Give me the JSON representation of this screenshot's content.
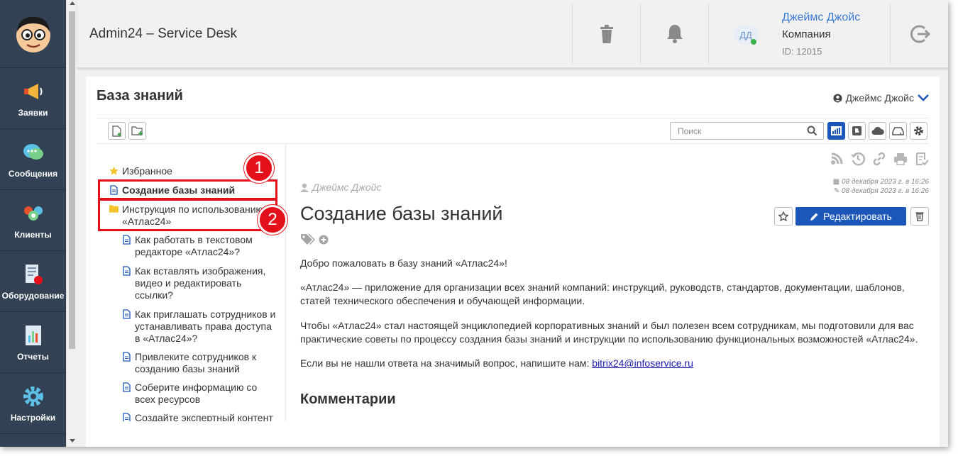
{
  "sidebar": {
    "items": [
      {
        "label": "Заявки",
        "icon": "megaphone-icon"
      },
      {
        "label": "Сообщения",
        "icon": "chat-bubble-icon"
      },
      {
        "label": "Клиенты",
        "icon": "users-icon"
      },
      {
        "label": "Оборудование",
        "icon": "equipment-icon"
      },
      {
        "label": "Отчеты",
        "icon": "report-icon"
      },
      {
        "label": "Настройки",
        "icon": "gear-icon"
      }
    ]
  },
  "header": {
    "title": "Admin24 – Service Desk",
    "user": {
      "initials": "ДД",
      "name": "Джеймс Джойс",
      "company": "Компания",
      "id": "ID: 12015"
    }
  },
  "kb": {
    "title": "База знаний",
    "user_name": "Джеймс Джойс",
    "search_placeholder": "Поиск"
  },
  "tree": {
    "items": [
      {
        "label": "Избранное",
        "icon": "star-icon"
      },
      {
        "label": "Создание базы знаний",
        "icon": "document-icon"
      },
      {
        "label": "Инструкция по использованию «Атлас24»",
        "icon": "folder-icon"
      },
      {
        "label": "Как работать в текстовом редакторе «Атлас24»?",
        "icon": "document-icon"
      },
      {
        "label": "Как вставлять изображения, видео и редактировать ссылки?",
        "icon": "document-icon"
      },
      {
        "label": "Как приглашать сотрудников и устанавливать права доступа в «Атлас24»?",
        "icon": "document-icon"
      },
      {
        "label": "Привлеките сотрудников к созданию базы знаний",
        "icon": "document-icon"
      },
      {
        "label": "Соберите информацию со всех ресурсов",
        "icon": "document-icon"
      },
      {
        "label": "Создайте экспертный контент",
        "icon": "document-icon"
      }
    ],
    "badges": [
      "1",
      "2"
    ]
  },
  "article": {
    "author": "Джеймс Джойс",
    "created": "08 декабря 2023 г. в 16:26",
    "modified": "08 декабря 2023 г. в 16:26",
    "title": "Создание базы знаний",
    "edit_label": "Редактировать",
    "p1": "Добро пожаловать в базу знаний «Атлас24»!",
    "p2": "«Атлас24» — приложение для организации всех знаний компаний: инструкций, руководств, стандартов, документации, шаблонов, статей технического обеспечения и обучающей информации.",
    "p3": "Чтобы «Атлас24» стал настоящей энциклопедией корпоративных знаний и был полезен всем сотрудникам, мы подготовили для вас практические советы по процессу создания базы знаний и инструкции по использованию функциональных возможностей «Атлас24».",
    "p4_prefix": "Если вы не нашли ответа на значимый вопрос, напишите нам: ",
    "p4_email": "bitrix24@infoservice.ru",
    "comments_title": "Комментарии"
  },
  "colors": {
    "sidebar": "#324153",
    "accent": "#1b56b8",
    "link": "#3a7bd5",
    "highlight": "#e3101b"
  }
}
